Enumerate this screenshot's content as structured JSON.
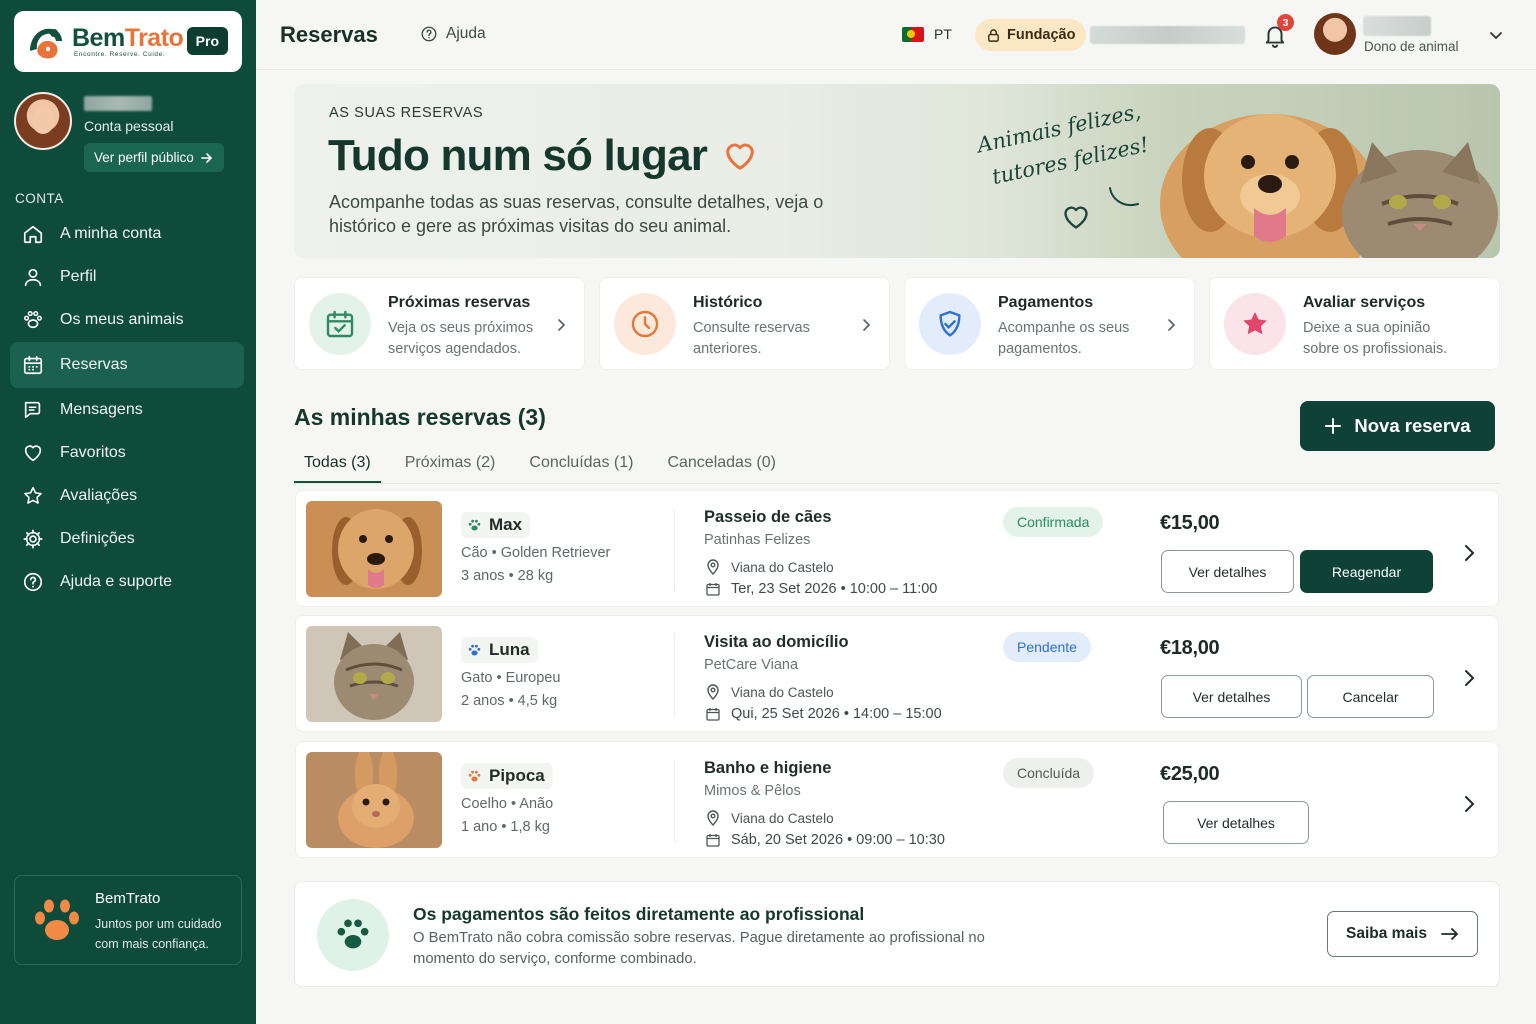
{
  "brand": {
    "name_part1": "Bem",
    "name_part2": "Trato",
    "tagline": "Encontre. Reserve. Cuide.",
    "plan_badge": "Pro"
  },
  "sidebar": {
    "profile": {
      "account_type": "Conta pessoal",
      "public_profile_button": "Ver perfil público"
    },
    "section_label": "CONTA",
    "items": [
      {
        "label": "A minha conta",
        "icon": "home-icon",
        "active": false
      },
      {
        "label": "Perfil",
        "icon": "user-icon",
        "active": false
      },
      {
        "label": "Os meus animais",
        "icon": "paw-icon",
        "active": false
      },
      {
        "label": "Reservas",
        "icon": "calendar-icon",
        "active": true
      },
      {
        "label": "Mensagens",
        "icon": "chat-icon",
        "active": false
      },
      {
        "label": "Favoritos",
        "icon": "heart-icon",
        "active": false
      },
      {
        "label": "Avaliações",
        "icon": "star-icon",
        "active": false
      },
      {
        "label": "Definições",
        "icon": "gear-icon",
        "active": false
      },
      {
        "label": "Ajuda e suporte",
        "icon": "help-icon",
        "active": false
      }
    ],
    "brand_card": {
      "title": "BemTrato",
      "subtitle": "Juntos por um cuidado com mais confiança."
    }
  },
  "header": {
    "title": "Reservas",
    "help": "Ajuda",
    "language": "PT",
    "organization": "Fundação",
    "notifications_count": "3",
    "user_role": "Dono de animal"
  },
  "hero": {
    "kicker": "AS SUAS RESERVAS",
    "title": "Tudo num só lugar",
    "subtitle": "Acompanhe todas as suas reservas, consulte detalhes, veja o histórico e gere as próximas visitas do seu animal.",
    "script_line1": "Animais felizes,",
    "script_line2": "tutores felizes!"
  },
  "features": [
    {
      "title": "Próximas reservas",
      "desc": "Veja os seus próximos serviços agendados.",
      "icon": "calendar-check-icon",
      "color": "#2f8a63",
      "bg": "#e3f3ea"
    },
    {
      "title": "Histórico",
      "desc": "Consulte reservas anteriores.",
      "icon": "clock-icon",
      "color": "#e0793a",
      "bg": "#fde9db"
    },
    {
      "title": "Pagamentos",
      "desc": "Acompanhe os seus pagamentos.",
      "icon": "shield-check-icon",
      "color": "#2f6fd6",
      "bg": "#e2ecfb"
    },
    {
      "title": "Avaliar serviços",
      "desc": "Deixe a sua opinião sobre os profissionais.",
      "icon": "star-icon",
      "color": "#e2466a",
      "bg": "#fbe3ea"
    }
  ],
  "reservations": {
    "title": "As minhas reservas (3)",
    "new_button": "Nova reserva",
    "tabs": [
      "Todas (3)",
      "Próximas (2)",
      "Concluídas (1)",
      "Canceladas (0)"
    ],
    "active_tab": 0,
    "items": [
      {
        "pet_name": "Max",
        "pet_species_breed": "Cão • Golden Retriever",
        "pet_age_weight": "3 anos • 28 kg",
        "paw_color": "#2f8a63",
        "service": "Passeio de cães",
        "provider": "Patinhas Felizes",
        "location": "Viana do Castelo",
        "datetime": "Ter, 23 Set 2026 • 10:00 – 11:00",
        "status": "Confirmada",
        "status_color": "#2f8a63",
        "status_bg": "#e3f3ea",
        "price": "€15,00",
        "actions": [
          "Ver detalhes",
          "Reagendar"
        ]
      },
      {
        "pet_name": "Luna",
        "pet_species_breed": "Gato • Europeu",
        "pet_age_weight": "2 anos • 4,5 kg",
        "paw_color": "#2f6fd6",
        "service": "Visita ao domicílio",
        "provider": "PetCare Viana",
        "location": "Viana do Castelo",
        "datetime": "Qui, 25 Set 2026 • 14:00 – 15:00",
        "status": "Pendente",
        "status_color": "#2f6fd6",
        "status_bg": "#e2ecfb",
        "price": "€18,00",
        "actions": [
          "Ver detalhes",
          "Cancelar"
        ]
      },
      {
        "pet_name": "Pipoca",
        "pet_species_breed": "Coelho • Anão",
        "pet_age_weight": "1 ano • 1,8 kg",
        "paw_color": "#e0793a",
        "service": "Banho e higiene",
        "provider": "Mimos & Pêlos",
        "location": "Viana do Castelo",
        "datetime": "Sáb, 20 Set 2026 • 09:00 – 10:30",
        "status": "Concluída",
        "status_color": "#4f5a55",
        "status_bg": "#eef0ee",
        "price": "€25,00",
        "actions": [
          "Ver detalhes"
        ]
      }
    ]
  },
  "info": {
    "title": "Os pagamentos são feitos diretamente ao profissional",
    "text": "O BemTrato não cobra comissão sobre reservas. Pague diretamente ao profissional no momento do serviço, conforme combinado.",
    "button": "Saiba mais"
  }
}
